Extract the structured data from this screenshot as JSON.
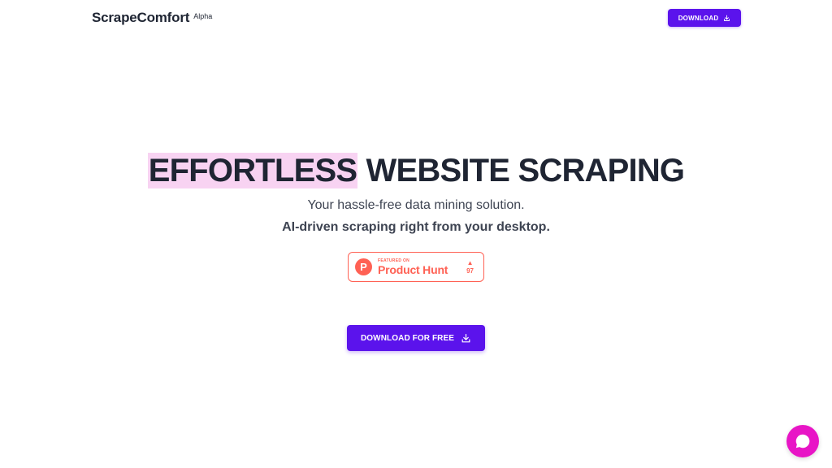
{
  "header": {
    "brand_name": "ScrapeComfort",
    "brand_badge": "Alpha",
    "download_label": "DOWNLOAD"
  },
  "hero": {
    "headline_highlight": "EFFORTLESS",
    "headline_rest": "WEBSITE SCRAPING",
    "subtitle": "Your hassle-free data mining solution.",
    "tagline": "AI-driven scraping right from your desktop."
  },
  "product_hunt": {
    "logo_letter": "P",
    "featured_label": "FEATURED ON",
    "name": "Product Hunt",
    "arrow": "▲",
    "votes": "97"
  },
  "cta": {
    "label": "DOWNLOAD FOR FREE"
  },
  "icons": {
    "download": "download-icon",
    "chat": "chat-icon"
  },
  "colors": {
    "accent": "#5b13ec",
    "highlight": "#f8d3f2",
    "product_hunt": "#ff6154",
    "chat": "#e815c6",
    "text": "#1f2533"
  }
}
